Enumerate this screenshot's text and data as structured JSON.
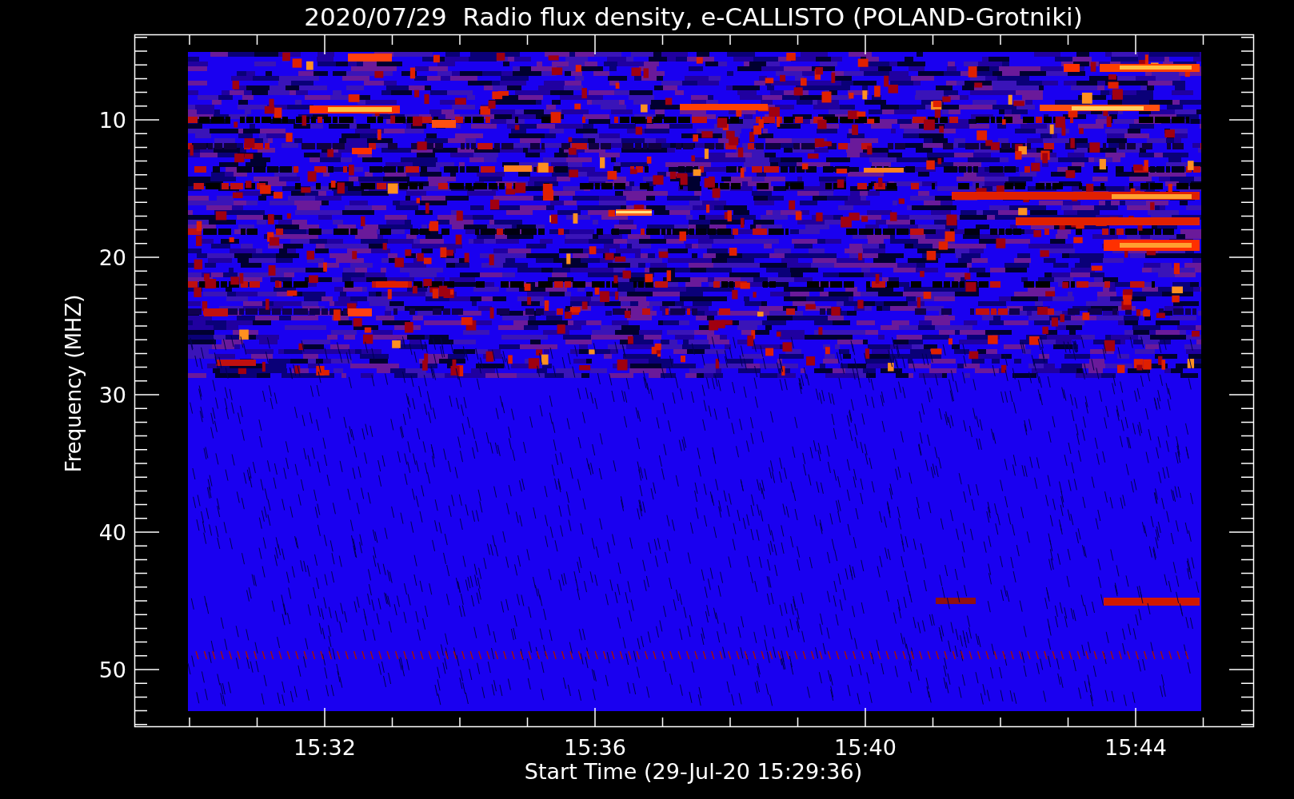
{
  "title": "2020/07/29  Radio flux density, e-CALLISTO (POLAND-Grotniki)",
  "y_axis": {
    "label": "Frequency (MHZ)",
    "ticks": [
      "10",
      "20",
      "30",
      "40",
      "50"
    ]
  },
  "x_axis": {
    "label": "Start Time (29-Jul-20 15:29:36)",
    "ticks": [
      "15:32",
      "15:36",
      "15:40",
      "15:44"
    ]
  }
}
